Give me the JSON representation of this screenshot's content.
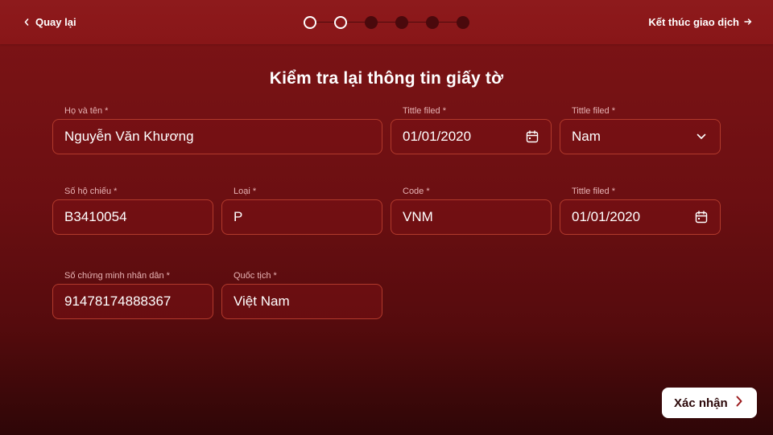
{
  "topbar": {
    "back_label": "Quay lại",
    "end_label": "Kết thúc giao dịch",
    "steps": [
      "done",
      "done",
      "todo",
      "todo",
      "todo",
      "todo"
    ]
  },
  "page_title": "Kiểm tra lại thông tin giấy tờ",
  "form": {
    "full_name": {
      "label": "Họ và tên *",
      "value": "Nguyễn Văn Khương"
    },
    "date_1": {
      "label": "Tittle filed *",
      "value": "01/01/2020"
    },
    "gender": {
      "label": "Tittle filed *",
      "value": "Nam"
    },
    "passport_no": {
      "label": "Số hộ chiếu *",
      "value": "B3410054"
    },
    "type": {
      "label": "Loại *",
      "value": "P"
    },
    "code": {
      "label": "Code *",
      "value": "VNM"
    },
    "date_2": {
      "label": "Tittle filed *",
      "value": "01/01/2020"
    },
    "id_no": {
      "label": "Số chứng minh nhân dân *",
      "value": "91478174888367"
    },
    "nationality": {
      "label": "Quốc tịch *",
      "value": "Việt Nam"
    }
  },
  "actions": {
    "confirm_label": "Xác nhận"
  },
  "icons": {
    "back": "chevron-left-icon",
    "end": "arrow-right-icon",
    "date": "calendar-icon",
    "dropdown": "chevron-down-icon",
    "confirm": "chevron-right-icon"
  },
  "colors": {
    "background": "#7e1416",
    "topbar": "#8e1a1c",
    "field_border": "#b23a2c",
    "label": "#e7b3b4",
    "button_bg": "#ffffff",
    "button_text": "#2a0607",
    "accent_arrow": "#9b1a1c"
  }
}
